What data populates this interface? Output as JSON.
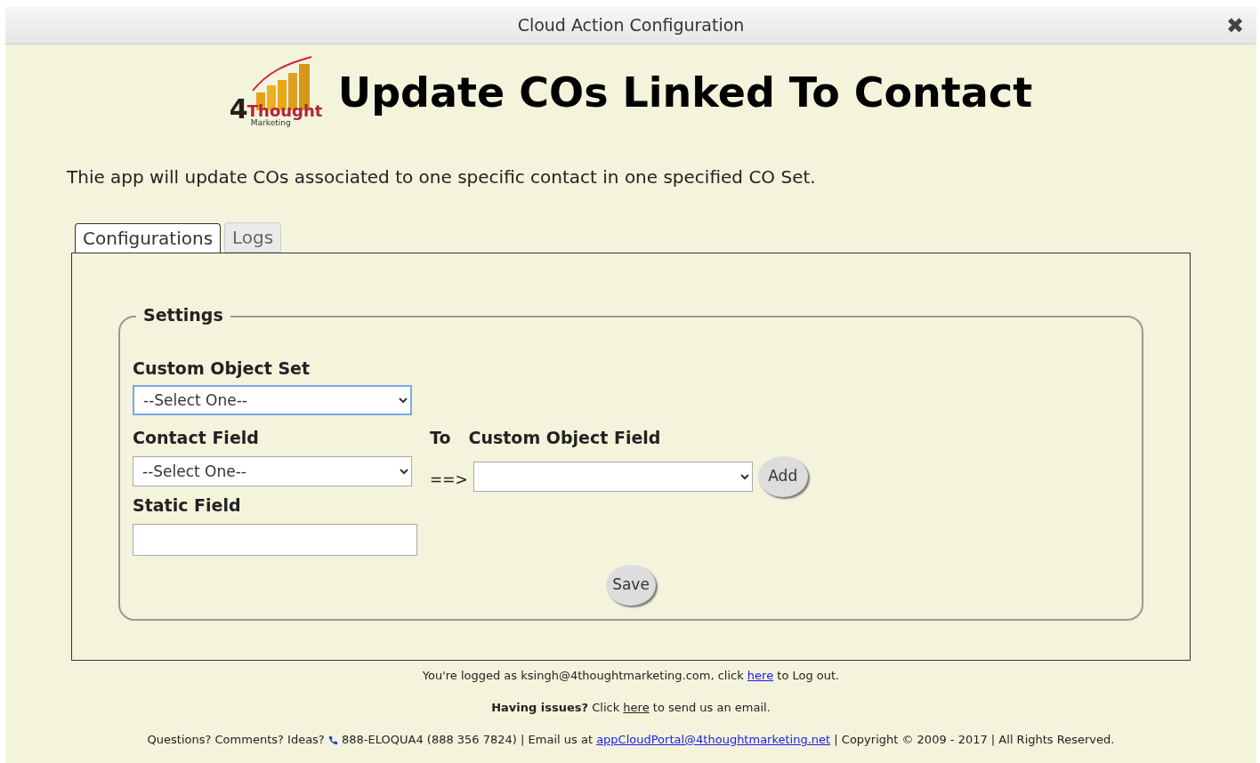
{
  "window": {
    "title": "Cloud Action Configuration",
    "close": "✖"
  },
  "logo": {
    "digit": "4",
    "word": "Thought",
    "subword": "Marketing"
  },
  "heading": "Update COs Linked To Contact",
  "description": "Thie app will update COs associated to one specific contact in one specified CO Set.",
  "tabs": [
    {
      "label": "Configurations",
      "selected": true
    },
    {
      "label": "Logs",
      "selected": false
    }
  ],
  "settings": {
    "legend": "Settings",
    "custom_object_set": {
      "label": "Custom Object Set",
      "value": "--Select One--",
      "focused": true
    },
    "contact_field": {
      "label": "Contact Field",
      "value": "--Select One--",
      "focused": false
    },
    "to_label": "To",
    "custom_object_field": {
      "label": "Custom Object Field",
      "focused": false
    },
    "arrow": "==>",
    "add_button": "Add",
    "static_field": {
      "label": "Static Field"
    },
    "save_button": "Save"
  },
  "footer": [
    {
      "segments": [
        {
          "kind": "text",
          "text": "You're logged as ksingh@4thoughtmarketing.com, click "
        },
        {
          "kind": "link",
          "text": "here",
          "visited": false
        },
        {
          "kind": "text",
          "text": " to Log out."
        }
      ]
    },
    {
      "segments": [
        {
          "kind": "text",
          "text": "**Having issues?** Click "
        },
        {
          "kind": "link",
          "text": "here",
          "visited": true
        },
        {
          "kind": "text",
          "text": " to send us an email."
        }
      ]
    },
    {
      "segments": [
        {
          "kind": "text",
          "text": "Questions? Comments? Ideas? "
        },
        {
          "kind": "phone"
        },
        {
          "kind": "text",
          "text": " 888-ELOQUA4 (888 356 7824) | Email us at "
        },
        {
          "kind": "link",
          "text": "appCloudPortal@4thoughtmarketing.net",
          "visited": false
        },
        {
          "kind": "text",
          "text": " | Copyright © 2009 - 2017 | All Rights Reserved."
        }
      ]
    }
  ]
}
